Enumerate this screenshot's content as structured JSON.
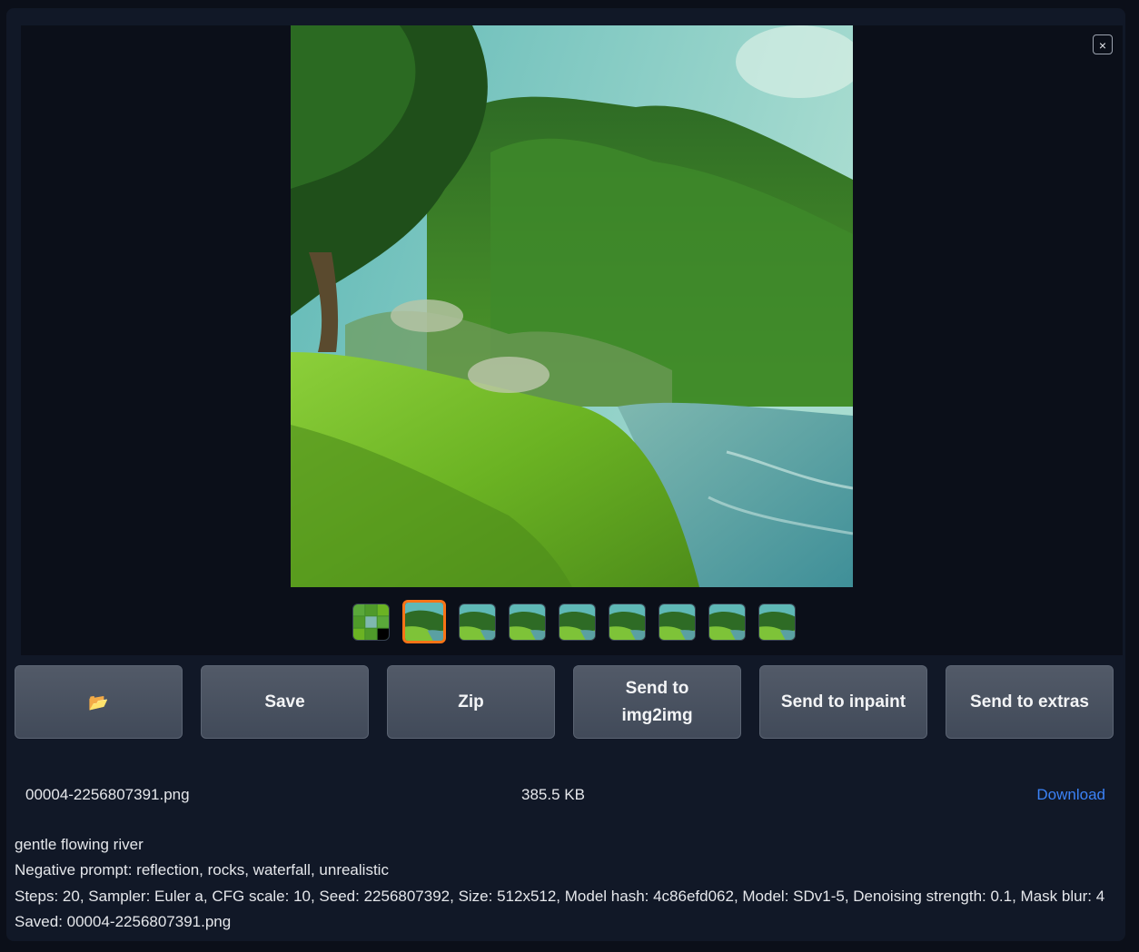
{
  "gallery": {
    "close_label": "×",
    "thumbnail_count": 9,
    "selected_index": 1
  },
  "actions": {
    "folder_icon": "📂",
    "save_label": "Save",
    "zip_label": "Zip",
    "send_img2img_label": "Send to img2img",
    "send_inpaint_label": "Send to inpaint",
    "send_extras_label": "Send to extras"
  },
  "file": {
    "name": "00004-2256807391.png",
    "size": "385.5 KB",
    "download_label": "Download"
  },
  "generation_info": {
    "prompt": "gentle flowing river",
    "negative_prompt": "Negative prompt: reflection, rocks, waterfall, unrealistic",
    "parameters": "Steps: 20, Sampler: Euler a, CFG scale: 10, Seed: 2256807392, Size: 512x512, Model hash: 4c86efd062, Model: SDv1-5, Denoising strength: 0.1, Mask blur: 4",
    "saved": "Saved: 00004-2256807391.png"
  },
  "colors": {
    "accent_selected": "#f97316",
    "link": "#3b82f6",
    "button_bg": "#4b5563",
    "panel_bg": "#111827",
    "page_bg": "#0b0f19"
  }
}
